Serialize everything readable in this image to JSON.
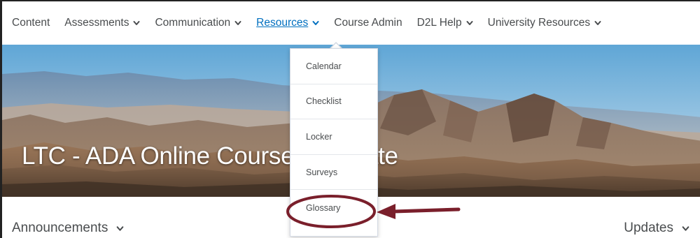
{
  "navbar": {
    "items": [
      {
        "label": "Content",
        "has_dropdown": false,
        "active": false
      },
      {
        "label": "Assessments",
        "has_dropdown": true,
        "active": false
      },
      {
        "label": "Communication",
        "has_dropdown": true,
        "active": false
      },
      {
        "label": "Resources",
        "has_dropdown": true,
        "active": true
      },
      {
        "label": "Course Admin",
        "has_dropdown": false,
        "active": false
      },
      {
        "label": "D2L Help",
        "has_dropdown": true,
        "active": false
      },
      {
        "label": "University Resources",
        "has_dropdown": true,
        "active": false
      }
    ]
  },
  "banner": {
    "title": "LTC - ADA Online Course Template"
  },
  "resources_menu": {
    "items": [
      "Calendar",
      "Checklist",
      "Locker",
      "Surveys",
      "Glossary"
    ],
    "highlighted": "Glossary"
  },
  "widgets": {
    "announcements_label": "Announcements",
    "updates_label": "Updates"
  },
  "colors": {
    "link_active": "#006fbf",
    "nav_text": "#494c4e",
    "annotation": "#7a1f2b"
  }
}
